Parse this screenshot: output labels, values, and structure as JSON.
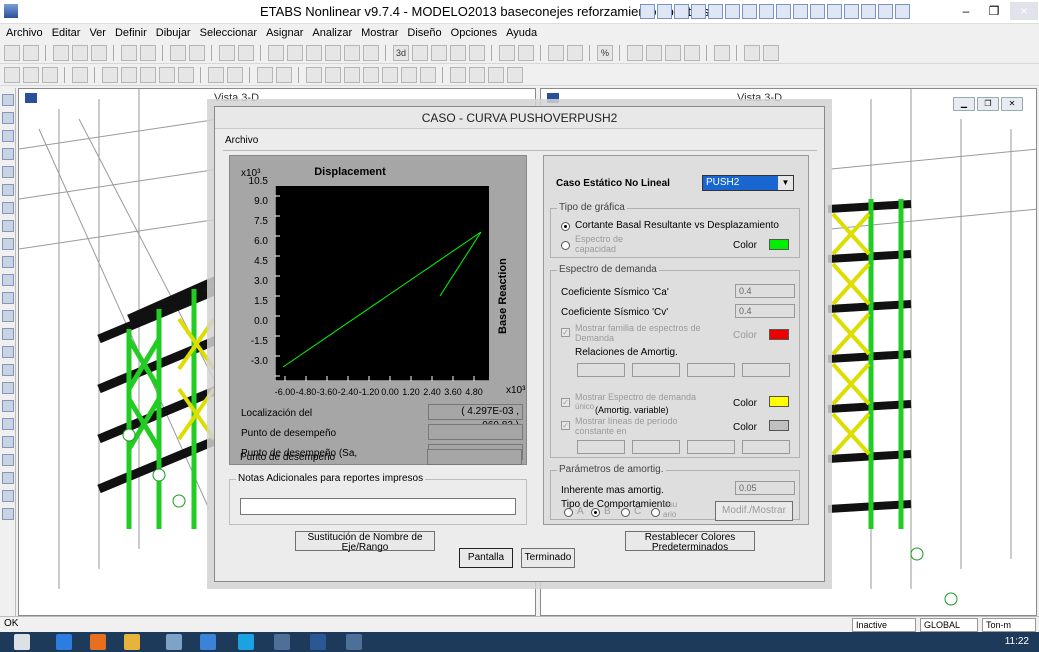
{
  "window": {
    "title": "ETABS Nonlinear v9.7.4 - MODELO2013 baseconejes reforzamiento solo tres p",
    "minimize": "–",
    "maximize": "❐",
    "close": "×"
  },
  "menu": [
    "Archivo",
    "Editar",
    "Ver",
    "Definir",
    "Dibujar",
    "Seleccionar",
    "Asignar",
    "Analizar",
    "Mostrar",
    "Diseño",
    "Opciones",
    "Ayuda"
  ],
  "toolbar1": {
    "zoom_text": "3d",
    "percent_text": "%"
  },
  "viewports": {
    "left_title": "Vista 3-D",
    "right_title": "Vista 3-D"
  },
  "dialog": {
    "title": "CASO - CURVA PUSHOVERPUSH2",
    "menu_archivo": "Archivo",
    "plot": {
      "title": "Displacement",
      "y_exponent": "x10³",
      "x_exponent": "x10³",
      "y_label": "Base Reaction",
      "y_ticks": [
        "10.5",
        "9.0",
        "7.5",
        "6.0",
        "4.5",
        "3.0",
        "1.5",
        "0.0",
        "-1.5",
        "-3.0"
      ],
      "x_ticks": [
        "-6.00",
        "-4.80",
        "-3.60",
        "-2.40",
        "-1.20",
        "0.00",
        "1.20",
        "2.40",
        "3.60",
        "4.80"
      ],
      "line_color": "#00ff00",
      "background": "#000000"
    },
    "info": {
      "localizacion_label": "Localización del",
      "localizacion_value": "( 4.297E-03 , 960.83 )",
      "punto1_label": "Punto de desempeño",
      "punto2_label": "Punto de desempeño (Sa,",
      "punto3_label": "Punto de desempeño"
    },
    "notes": {
      "legend": "Notas Adicionales para reportes impresos",
      "value": ""
    },
    "right": {
      "case_label": "Caso Estático No Lineal",
      "case_value": "PUSH2",
      "tipo_grafica_legend": "Tipo de gráfica",
      "radio1_label": "Cortante Basal Resultante vs Desplazamiento",
      "radio2_label_a": "Espectro de",
      "radio2_label_b": "capacidad",
      "color_label": "Color",
      "color_green": "#00ee00",
      "espectro_legend": "Espectro de demanda",
      "ca_label": "Coeficiente Sísmico 'Ca'",
      "ca_value": "0.4",
      "cv_label": "Coeficiente Sísmico 'Cv'",
      "cv_value": "0.4",
      "mostrar_familia_a": "Mostrar familia de espectros de",
      "mostrar_familia_b": "Demanda",
      "color_red": "#ee0000",
      "relaciones_label": "Relaciones de Amortig.",
      "mostrar_unico_a": "Mostrar Espectro de demanda",
      "mostrar_unico_b": "único",
      "amortig_variable": "(Amortig. variable)",
      "color_yellow": "#ffff00",
      "mostrar_lineas_a": "Mostrar líneas de período",
      "mostrar_lineas_b": "constante en",
      "color_gray": "#c0c0c0",
      "parametros_legend": "Parámetros de amortig.",
      "inherente_label": "Inherente mas amortig.",
      "inherente_value": "0.05",
      "tipo_comp_label": "Tipo de Comportamiento",
      "opt_a": "A",
      "opt_b": "B",
      "opt_c": "C",
      "opt_usu_a": "Usu",
      "opt_usu_b": "ario",
      "modif_button": "Modif./Mostrar"
    },
    "buttons": {
      "sustitucion_a": "Sustitución de Nombre de",
      "sustitucion_b": "Eje/Rango",
      "restablecer_a": "Restablecer Colores",
      "restablecer_b": "Predeterminados",
      "pantalla": "Pantalla",
      "terminado": "Terminado"
    }
  },
  "statusbar": {
    "ok": "OK",
    "inactive": "Inactive",
    "global": "GLOBAL",
    "units": "Ton-m"
  },
  "taskbar": {
    "clock": "11:22"
  }
}
